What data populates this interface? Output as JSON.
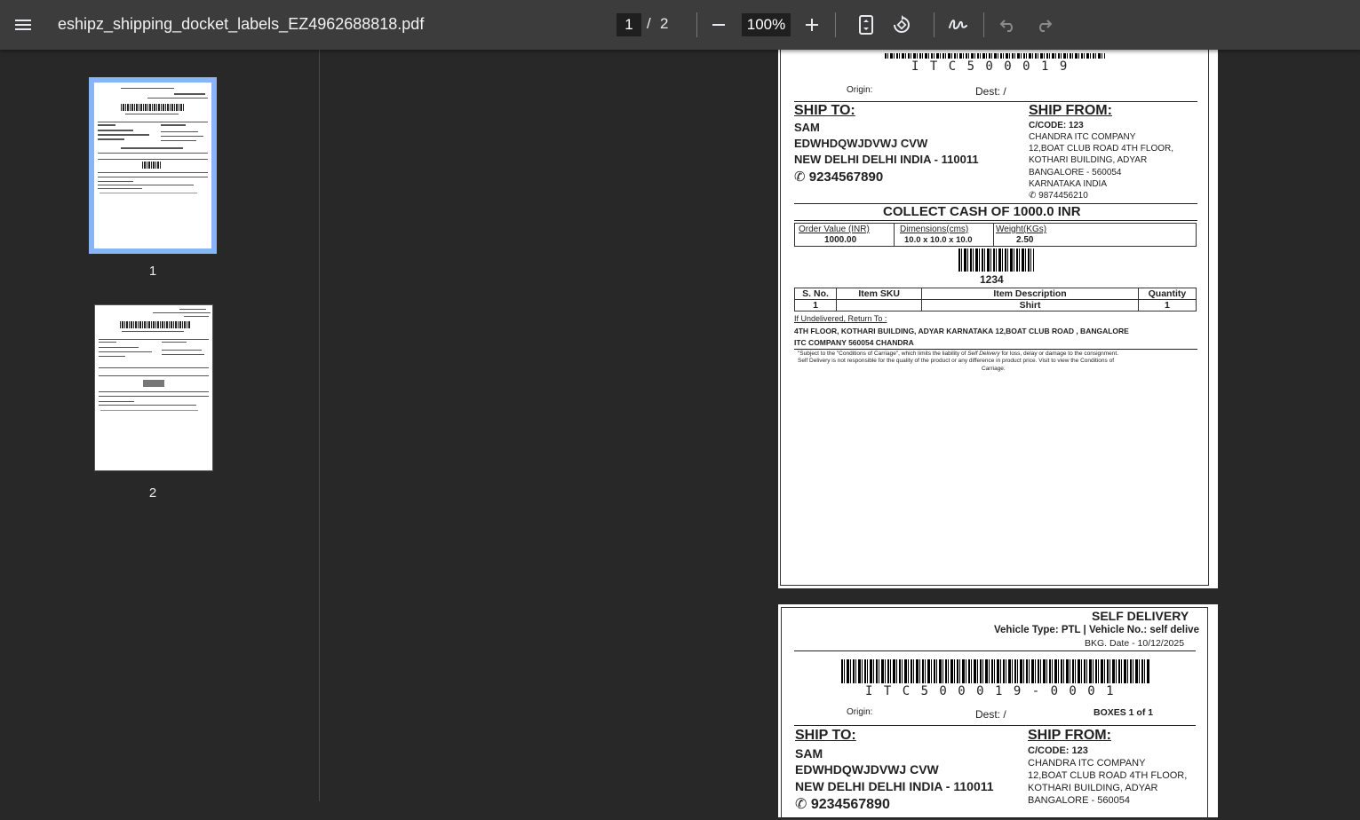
{
  "toolbar": {
    "filename": "eshipz_shipping_docket_labels_EZ4962688818.pdf",
    "current_page": "1",
    "separator": "/",
    "total_pages": "2",
    "zoom": "100%"
  },
  "sidebar": {
    "thumbnails": [
      {
        "label": "1",
        "selected": true
      },
      {
        "label": "2",
        "selected": false
      }
    ]
  },
  "page1": {
    "barcode_text": "I T C 5 0 0 0 1 9",
    "origin": "Origin:",
    "dest": "Dest: /",
    "ship_to_heading": "SHIP TO:",
    "ship_to_name": "SAM",
    "ship_to_line1": "EDWHDQWJDVWJ CVW",
    "ship_to_line2": "NEW DELHI DELHI INDIA - 110011",
    "ship_to_phone": "9234567890",
    "ship_from_heading": "SHIP FROM:",
    "ship_from_code": "C/CODE: 123",
    "ship_from_line1": "CHANDRA ITC COMPANY",
    "ship_from_line2": "12,BOAT CLUB ROAD 4TH FLOOR,",
    "ship_from_line3": "KOTHARI BUILDING, ADYAR",
    "ship_from_line4": "BANGALORE - 560054",
    "ship_from_line5": "KARNATAKA INDIA",
    "ship_from_phone": "9874456210",
    "collect": "COLLECT CASH OF 1000.0 INR",
    "order_value_label": "Order Value (INR)",
    "order_value": "1000.00",
    "dimensions_label": "Dimensions(cms)",
    "dimensions": "10.0 x 10.0 x 10.0",
    "weight_label": "Weight(KGs)",
    "weight": "2.50",
    "sku_barcode_text": "1234",
    "col_sno": "S. No.",
    "col_sku": "Item SKU",
    "col_desc": "Item Description",
    "col_qty": "Quantity",
    "row_sno": "1",
    "row_sku": "",
    "row_desc": "Shirt",
    "row_qty": "1",
    "return_heading": "If Undelivered, Return To :",
    "return_line1": "4TH FLOOR, KOTHARI BUILDING, ADYAR KARNATAKA 12,BOAT CLUB ROAD , BANGALORE",
    "return_line2": "ITC COMPANY 560054 CHANDRA",
    "disclaimer1_a": "\"Subject to the \"Conditions of Carriage\", which limits the liability of ",
    "disclaimer1_b": "Self Delivery",
    "disclaimer1_c": " for loss, delay or damage to the consignment.",
    "disclaimer2": "Self Delivery is not responsible for the quality of the product or any difference in product price. Visit to view the Conditions of",
    "disclaimer3": "Carriage."
  },
  "page2": {
    "self_delivery": "SELF DELIVERY",
    "vehicle": "Vehicle Type: PTL | Vehicle No.: self delive",
    "bkg_date": "BKG. Date - 10/12/2025",
    "barcode_text": "I T C 5 0 0 0 1 9 - 0 0 0 1",
    "origin": "Origin:",
    "dest": "Dest: /",
    "boxes": "BOXES 1 of 1",
    "ship_to_heading": "SHIP TO:",
    "ship_to_name": "SAM",
    "ship_to_line1": "EDWHDQWJDVWJ CVW",
    "ship_to_line2": "NEW DELHI DELHI INDIA - 110011",
    "ship_to_phone": "9234567890",
    "ship_from_heading": "SHIP FROM:",
    "ship_from_code": "C/CODE: 123",
    "ship_from_line1": "CHANDRA ITC COMPANY",
    "ship_from_line2": "12,BOAT CLUB ROAD 4TH FLOOR,",
    "ship_from_line3": "KOTHARI BUILDING, ADYAR",
    "ship_from_line4": "BANGALORE - 560054"
  },
  "icons": {
    "menu": "menu-icon",
    "zoom_out": "minus-icon",
    "zoom_in": "plus-icon",
    "fit": "fit-page-icon",
    "rotate": "rotate-icon",
    "annotate": "draw-icon",
    "undo": "undo-icon",
    "redo": "redo-icon",
    "phone": "phone-icon"
  },
  "colors": {
    "toolbar": "#3c3c3c",
    "background": "#282828",
    "thumb_selection": "#8ab4f8"
  }
}
